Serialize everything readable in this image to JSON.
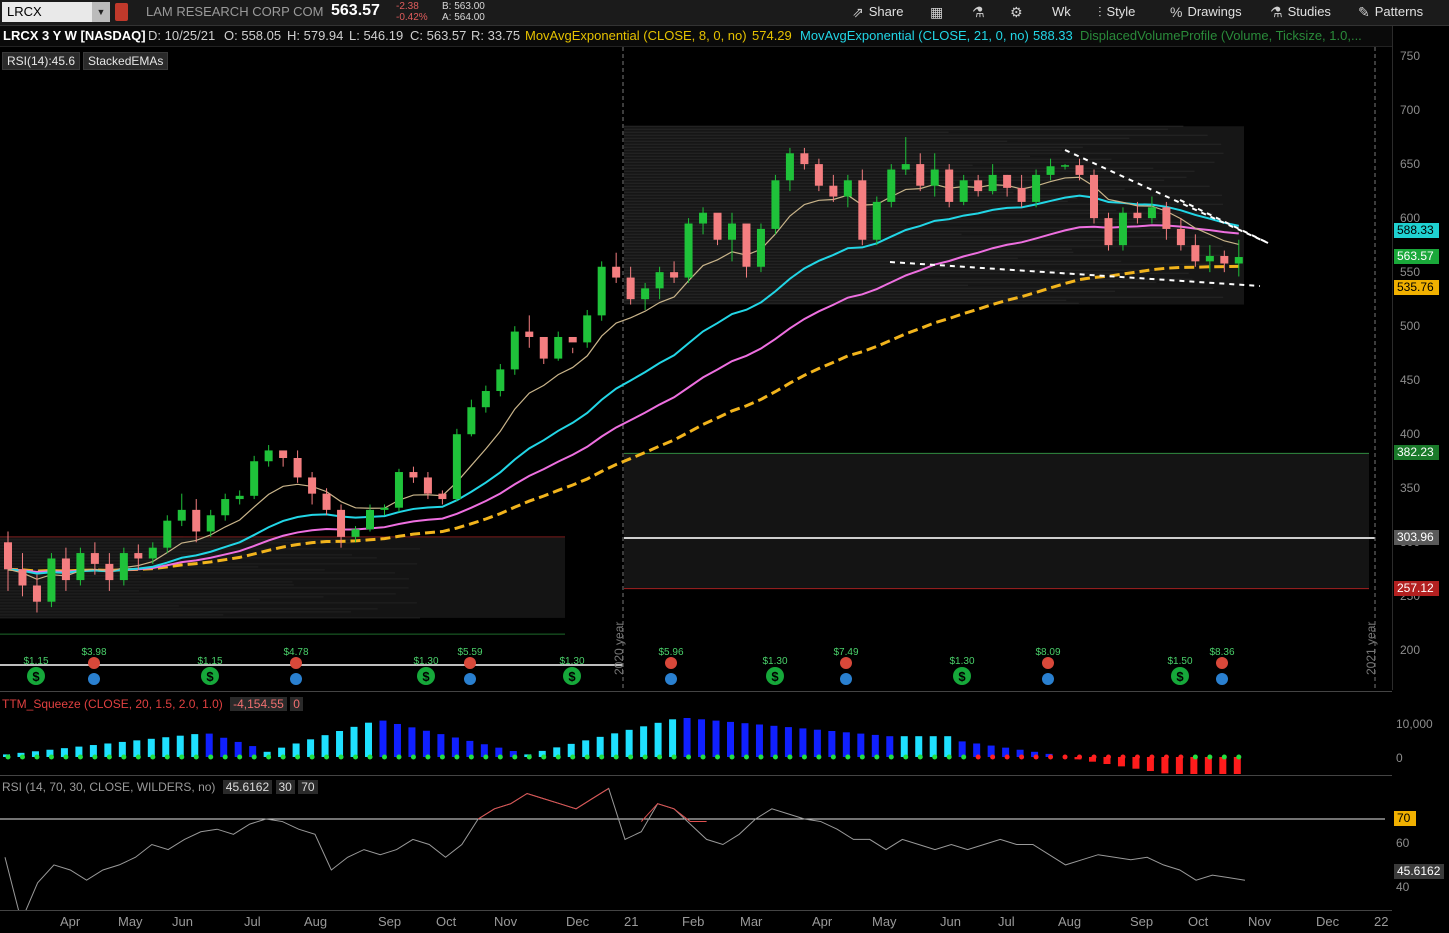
{
  "toolbar": {
    "symbol": "LRCX",
    "company": "LAM RESEARCH CORP COM",
    "last": "563.57",
    "change": "-2.38",
    "change_pct": "-0.42%",
    "bid": "B: 563.00",
    "ask": "A: 564.00",
    "buttons": {
      "share": "Share",
      "wk": "Wk",
      "style": "Style",
      "drawings": "Drawings",
      "studies": "Studies",
      "patterns": "Patterns"
    },
    "icons": [
      "share-icon",
      "calendar-icon",
      "flask-icon",
      "gear-icon",
      "style-icon",
      "drawings-icon",
      "studies-icon",
      "patterns-icon"
    ]
  },
  "infobar": {
    "symbol_desc": "LRCX 3 Y W [NASDAQ]",
    "date": "D: 10/25/21",
    "open": "O: 558.05",
    "high": "H: 579.94",
    "low": "L: 546.19",
    "close": "C: 563.57",
    "range": "R: 33.75",
    "ema8_label": "MovAvgExponential (CLOSE, 8, 0, no)",
    "ema8_value": "574.29",
    "ema21_label": "MovAvgExponential (CLOSE, 21, 0, no)",
    "ema21_value": "588.33",
    "dvp_label": "DisplacedVolumeProfile (Volume, Ticksize, 1.0,..."
  },
  "studies": [
    "RSI(14):45.6",
    "StackedEMAs"
  ],
  "price_axis": {
    "ticks": [
      "750",
      "700",
      "650",
      "600",
      "550",
      "500",
      "450",
      "400",
      "350",
      "300",
      "250",
      "200"
    ],
    "badges": [
      {
        "value": "588.33",
        "bg": "#1fd1d1",
        "fg": "#000"
      },
      {
        "value": "563.57",
        "bg": "#1aa83a",
        "fg": "#fff"
      },
      {
        "value": "535.76",
        "bg": "#f0b000",
        "fg": "#000"
      },
      {
        "value": "382.23",
        "bg": "#1a7a2a",
        "fg": "#fff"
      },
      {
        "value": "303.96",
        "bg": "#5a5a5a",
        "fg": "#fff"
      },
      {
        "value": "257.12",
        "bg": "#b22020",
        "fg": "#fff"
      }
    ]
  },
  "year_labels": [
    "2020 year",
    "2021 year"
  ],
  "events": [
    {
      "type": "div",
      "label": "$1.15"
    },
    {
      "type": "earn",
      "label": "$3.98"
    },
    {
      "type": "div",
      "label": "$1.15"
    },
    {
      "type": "earn",
      "label": "$4.78"
    },
    {
      "type": "div",
      "label": "$1.30"
    },
    {
      "type": "earn",
      "label": "$5.59"
    },
    {
      "type": "div",
      "label": "$1.30"
    },
    {
      "type": "earn",
      "label": "$5.96"
    },
    {
      "type": "div",
      "label": "$1.30"
    },
    {
      "type": "earn",
      "label": "$7.49"
    },
    {
      "type": "div",
      "label": "$1.30"
    },
    {
      "type": "earn",
      "label": "$8.09"
    },
    {
      "type": "div",
      "label": "$1.50"
    },
    {
      "type": "earn",
      "label": "$8.36"
    }
  ],
  "squeeze": {
    "title": "TTM_Squeeze (CLOSE, 20, 1.5, 2.0, 1.0)",
    "value": "-4,154.55",
    "zero": "0",
    "ticks": [
      "10,000",
      "0"
    ]
  },
  "rsi": {
    "title": "RSI (14, 70, 30, CLOSE, WILDERS, no)",
    "value": "45.6162",
    "ob": "30",
    "os": "70",
    "ticks": [
      "60",
      "40"
    ],
    "badges": [
      {
        "value": "70",
        "bg": "#f0b000",
        "fg": "#000"
      },
      {
        "value": "45.6162",
        "bg": "#3a3a3a",
        "fg": "#fff"
      }
    ]
  },
  "time_axis": [
    "Apr",
    "May",
    "Jun",
    "Jul",
    "Aug",
    "Sep",
    "Oct",
    "Nov",
    "Dec",
    "21",
    "Feb",
    "Mar",
    "Apr",
    "May",
    "Jun",
    "Jul",
    "Aug",
    "Sep",
    "Oct",
    "Nov",
    "Dec",
    "22"
  ],
  "colors": {
    "up": "#1fc23a",
    "down": "#f47e80",
    "ema8": "#c9b48a",
    "ema21": "#22d6e6",
    "ema34": "#ee6fe0",
    "ema55": "#f2b41c"
  },
  "chart_data": {
    "type": "candlestick",
    "series": [
      {
        "name": "LRCX",
        "ohlc": [
          [
            300,
            310,
            255,
            275
          ],
          [
            275,
            290,
            250,
            260
          ],
          [
            260,
            270,
            235,
            245
          ],
          [
            245,
            290,
            240,
            285
          ],
          [
            285,
            295,
            255,
            265
          ],
          [
            265,
            295,
            260,
            290
          ],
          [
            290,
            300,
            270,
            280
          ],
          [
            280,
            290,
            255,
            265
          ],
          [
            265,
            295,
            260,
            290
          ],
          [
            290,
            298,
            275,
            285
          ],
          [
            285,
            300,
            280,
            295
          ],
          [
            295,
            325,
            290,
            320
          ],
          [
            320,
            345,
            315,
            330
          ],
          [
            330,
            340,
            300,
            310
          ],
          [
            310,
            330,
            305,
            325
          ],
          [
            325,
            345,
            320,
            340
          ],
          [
            340,
            348,
            335,
            343
          ],
          [
            343,
            380,
            340,
            375
          ],
          [
            375,
            390,
            370,
            385
          ],
          [
            385,
            383,
            370,
            378
          ],
          [
            378,
            385,
            355,
            360
          ],
          [
            360,
            365,
            335,
            345
          ],
          [
            345,
            350,
            325,
            330
          ],
          [
            330,
            335,
            295,
            305
          ],
          [
            305,
            315,
            300,
            312
          ],
          [
            312,
            335,
            310,
            330
          ],
          [
            330,
            335,
            325,
            332
          ],
          [
            332,
            368,
            328,
            365
          ],
          [
            365,
            370,
            355,
            360
          ],
          [
            360,
            365,
            340,
            345
          ],
          [
            345,
            348,
            335,
            340
          ],
          [
            340,
            405,
            338,
            400
          ],
          [
            400,
            432,
            398,
            425
          ],
          [
            425,
            445,
            420,
            440
          ],
          [
            440,
            465,
            435,
            460
          ],
          [
            460,
            500,
            455,
            495
          ],
          [
            495,
            510,
            480,
            490
          ],
          [
            490,
            485,
            465,
            470
          ],
          [
            470,
            495,
            468,
            490
          ],
          [
            490,
            475,
            480,
            485
          ],
          [
            485,
            515,
            480,
            510
          ],
          [
            510,
            560,
            505,
            555
          ],
          [
            555,
            568,
            540,
            545
          ],
          [
            545,
            555,
            520,
            525
          ],
          [
            525,
            540,
            515,
            535
          ],
          [
            535,
            555,
            525,
            550
          ],
          [
            550,
            560,
            540,
            545
          ],
          [
            545,
            600,
            540,
            595
          ],
          [
            595,
            610,
            585,
            605
          ],
          [
            605,
            600,
            575,
            580
          ],
          [
            580,
            605,
            560,
            595
          ],
          [
            595,
            590,
            545,
            555
          ],
          [
            555,
            595,
            550,
            590
          ],
          [
            590,
            640,
            585,
            635
          ],
          [
            635,
            665,
            625,
            660
          ],
          [
            660,
            665,
            645,
            650
          ],
          [
            650,
            655,
            625,
            630
          ],
          [
            630,
            640,
            615,
            620
          ],
          [
            620,
            640,
            610,
            635
          ],
          [
            635,
            645,
            575,
            580
          ],
          [
            580,
            620,
            575,
            615
          ],
          [
            615,
            650,
            610,
            645
          ],
          [
            645,
            675,
            640,
            650
          ],
          [
            650,
            660,
            625,
            630
          ],
          [
            630,
            660,
            620,
            645
          ],
          [
            645,
            650,
            610,
            615
          ],
          [
            615,
            640,
            612,
            635
          ],
          [
            635,
            640,
            620,
            625
          ],
          [
            625,
            650,
            622,
            640
          ],
          [
            640,
            640,
            620,
            628
          ],
          [
            628,
            640,
            610,
            615
          ],
          [
            615,
            645,
            610,
            640
          ],
          [
            640,
            655,
            635,
            648
          ],
          [
            648,
            650,
            645,
            649
          ],
          [
            649,
            655,
            635,
            640
          ],
          [
            640,
            645,
            595,
            600
          ],
          [
            600,
            605,
            570,
            575
          ],
          [
            575,
            610,
            570,
            605
          ],
          [
            605,
            615,
            595,
            600
          ],
          [
            600,
            620,
            595,
            610
          ],
          [
            610,
            615,
            580,
            590
          ],
          [
            590,
            600,
            570,
            575
          ],
          [
            575,
            585,
            555,
            560
          ],
          [
            560,
            575,
            550,
            565
          ],
          [
            565,
            570,
            550,
            558
          ],
          [
            558,
            580,
            546,
            564
          ]
        ]
      }
    ]
  }
}
